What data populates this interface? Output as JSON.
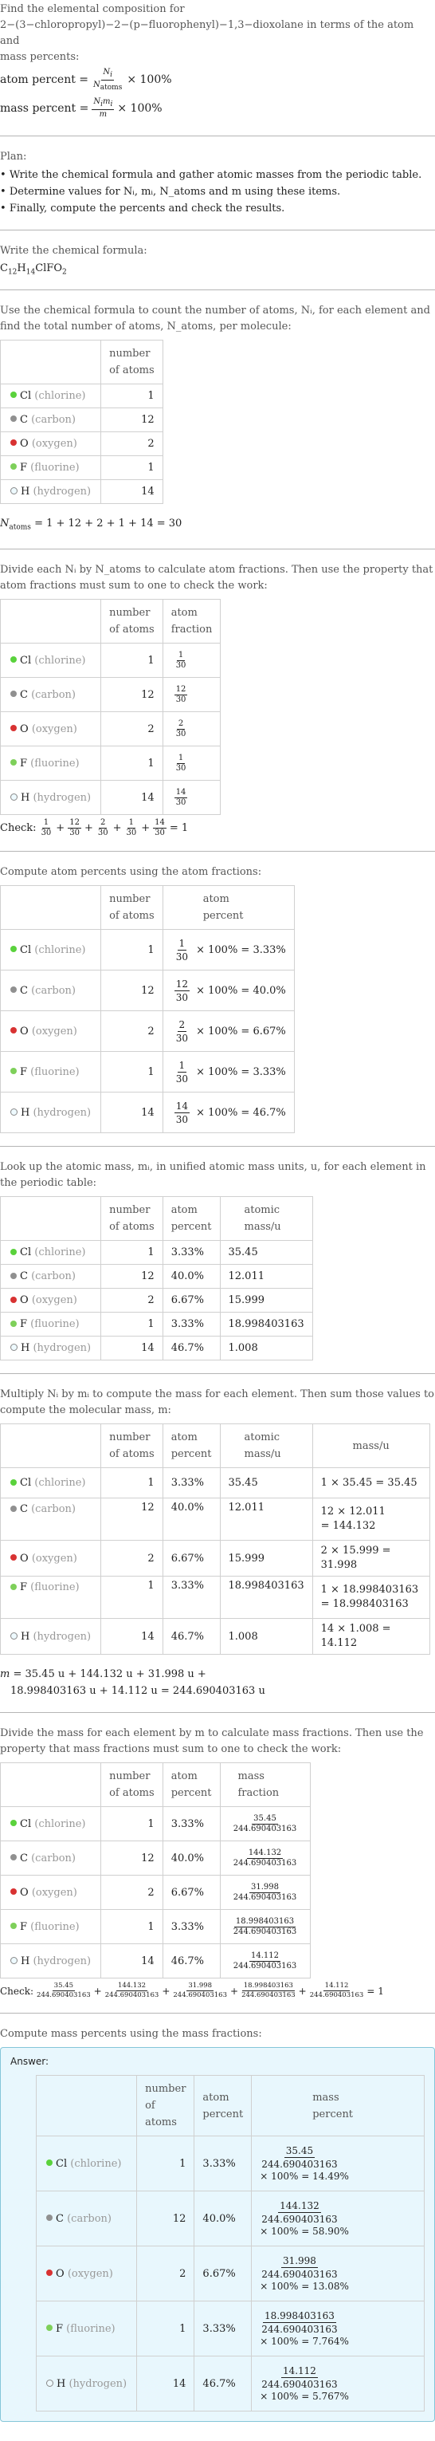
{
  "intro": {
    "line1": "Find the elemental composition for",
    "line2": "2−(3−chloropropyl)−2−(p−fluorophenyl)−1,3−dioxolane in terms of the atom and",
    "line3": "mass percents:",
    "atom_percent_label": "atom percent =",
    "mass_percent_label": "mass percent =",
    "times_100": "× 100%"
  },
  "plan": {
    "title": "Plan:",
    "items": [
      "Write the chemical formula and gather atomic masses from the periodic table.",
      "Determine values for Nᵢ, mᵢ, N_atoms and m using these items.",
      "Finally, compute the percents and check the results."
    ]
  },
  "formula_step": {
    "text": "Write the chemical formula:",
    "formula": "C12H14ClFO2"
  },
  "count_step": {
    "text": "Use the chemical formula to count the number of atoms, Nᵢ, for each element and find the total number of atoms, N_atoms, per molecule:",
    "natoms_equation": "= 1 + 12 + 2 + 1 + 14 = 30"
  },
  "elements": [
    {
      "symbol": "Cl",
      "name": "(chlorine)",
      "color": "#5ad23c",
      "count": "1",
      "fraction_num": "1",
      "fraction_den": "30",
      "atom_percent": "3.33%",
      "atomic_mass": "35.45",
      "mass_expr_1": "1 × 35.45 = 35.45",
      "mass_expr_2": "",
      "mass": "35.45",
      "mass_percent": "14.49%"
    },
    {
      "symbol": "C",
      "name": "(carbon)",
      "color": "#909090",
      "count": "12",
      "fraction_num": "12",
      "fraction_den": "30",
      "atom_percent": "40.0%",
      "atomic_mass": "12.011",
      "mass_expr_1": "12 × 12.011",
      "mass_expr_2": "= 144.132",
      "mass": "144.132",
      "mass_percent": "58.90%"
    },
    {
      "symbol": "O",
      "name": "(oxygen)",
      "color": "#d83232",
      "count": "2",
      "fraction_num": "2",
      "fraction_den": "30",
      "atom_percent": "6.67%",
      "atomic_mass": "15.999",
      "mass_expr_1": "2 × 15.999 = 31.998",
      "mass_expr_2": "",
      "mass": "31.998",
      "mass_percent": "13.08%"
    },
    {
      "symbol": "F",
      "name": "(fluorine)",
      "color": "#7ed05a",
      "count": "1",
      "fraction_num": "1",
      "fraction_den": "30",
      "atom_percent": "3.33%",
      "atomic_mass": "18.998403163",
      "mass_expr_1": "1 × 18.998403163",
      "mass_expr_2": "= 18.998403163",
      "mass": "18.998403163",
      "mass_percent": "7.764%"
    },
    {
      "symbol": "H",
      "name": "(hydrogen)",
      "color": "#eefaff",
      "count": "14",
      "fraction_num": "14",
      "fraction_den": "30",
      "atom_percent": "46.7%",
      "atomic_mass": "1.008",
      "mass_expr_1": "14 × 1.008 = 14.112",
      "mass_expr_2": "",
      "mass": "14.112",
      "mass_percent": "5.767%"
    }
  ],
  "headers": {
    "number_of_atoms": [
      "number",
      "of atoms"
    ],
    "atom_fraction": [
      "atom",
      "fraction"
    ],
    "atom_percent": [
      "atom",
      "percent"
    ],
    "atomic_mass": [
      "atomic",
      "mass/u"
    ],
    "mass": "mass/u",
    "mass_fraction": [
      "mass",
      "fraction"
    ],
    "mass_percent": [
      "mass",
      "percent"
    ]
  },
  "fraction_step": {
    "text": "Divide each Nᵢ by N_atoms to calculate atom fractions. Then use the property that atom fractions must sum to one to check the work:",
    "check_label": "Check:",
    "check_result": "= 1"
  },
  "atom_percent_step": {
    "text": "Compute atom percents using the atom fractions:",
    "times_100": "× 100% ="
  },
  "atomic_mass_step": {
    "text": "Look up the atomic mass, mᵢ, in unified atomic mass units, u, for each element in the periodic table:"
  },
  "molecular_mass_step": {
    "text": "Multiply Nᵢ by mᵢ to compute the mass for each element. Then sum those values to compute the molecular mass, m:",
    "equation_line1": "= 35.45 u + 144.132 u + 31.998 u +",
    "equation_line2": "18.998403163 u + 14.112 u = 244.690403163 u",
    "molecular_mass": "244.690403163"
  },
  "mass_fraction_step": {
    "text": "Divide the mass for each element by m to calculate mass fractions. Then use the property that mass fractions must sum to one to check the work:",
    "check_label": "Check:",
    "check_result": "= 1"
  },
  "mass_percent_step": {
    "text": "Compute mass percents using the mass fractions:",
    "answer_label": "Answer:",
    "times_100": "× 100% ="
  }
}
